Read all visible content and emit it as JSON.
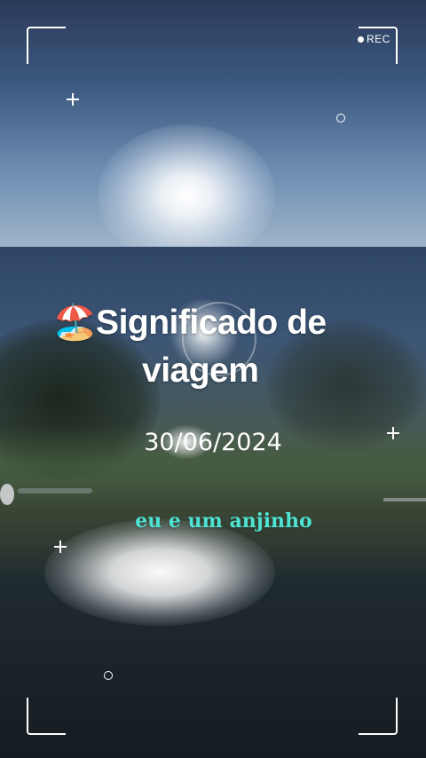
{
  "recording": {
    "label": "REC"
  },
  "title": {
    "line1": "🏖️Significado de",
    "line2": "viagem"
  },
  "date": "30/06/2024",
  "caption": "eu e  um anjinho",
  "colors": {
    "caption": "#4fe3d4",
    "frame": "#ffffff"
  }
}
